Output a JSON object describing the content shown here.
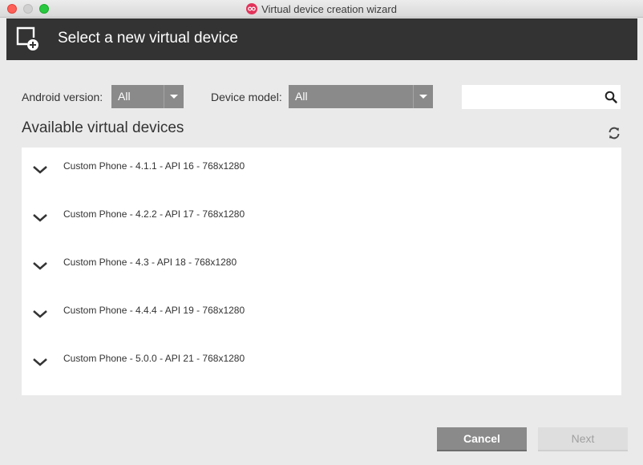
{
  "window": {
    "title": "Virtual device creation wizard"
  },
  "header": {
    "title": "Select a new virtual device"
  },
  "filters": {
    "android_version_label": "Android version:",
    "android_version_value": "All",
    "device_model_label": "Device model:",
    "device_model_value": "All",
    "search_placeholder": ""
  },
  "list": {
    "title": "Available virtual devices",
    "items": [
      {
        "label": "Custom Phone - 4.1.1 - API 16 - 768x1280"
      },
      {
        "label": "Custom Phone - 4.2.2 - API 17 - 768x1280"
      },
      {
        "label": "Custom Phone - 4.3 - API 18 - 768x1280"
      },
      {
        "label": "Custom Phone - 4.4.4 - API 19 - 768x1280"
      },
      {
        "label": "Custom Phone - 5.0.0 - API 21 - 768x1280"
      }
    ]
  },
  "buttons": {
    "cancel": "Cancel",
    "next": "Next"
  },
  "icons": {
    "header": "add-device-icon",
    "search": "search-icon",
    "refresh": "refresh-icon",
    "expand": "chevron-down-icon",
    "app": "genymotion-logo-icon"
  },
  "colors": {
    "header_bg": "#333333",
    "select_bg": "#8a8a8a",
    "accent_logo": "#e2335a"
  }
}
